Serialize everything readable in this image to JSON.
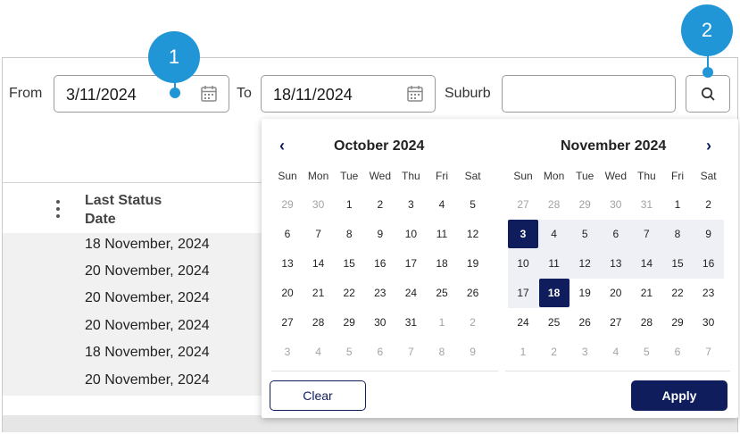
{
  "filter": {
    "from_label": "From",
    "from_value": "3/11/2024",
    "to_label": "To",
    "to_value": "18/11/2024",
    "suburb_label": "Suburb",
    "suburb_value": ""
  },
  "table": {
    "column_header_line1": "Last Status",
    "column_header_line2": "Date",
    "rows": [
      "18 November, 2024",
      "20 November, 2024",
      "20 November, 2024",
      "20 November, 2024",
      "18 November, 2024",
      "20 November, 2024"
    ]
  },
  "datepicker": {
    "weekdays": [
      "Sun",
      "Mon",
      "Tue",
      "Wed",
      "Thu",
      "Fri",
      "Sat"
    ],
    "left": {
      "title": "October 2024",
      "weeks": [
        [
          "29",
          "30",
          "1",
          "2",
          "3",
          "4",
          "5"
        ],
        [
          "6",
          "7",
          "8",
          "9",
          "10",
          "11",
          "12"
        ],
        [
          "13",
          "14",
          "15",
          "16",
          "17",
          "18",
          "19"
        ],
        [
          "20",
          "21",
          "22",
          "23",
          "24",
          "25",
          "26"
        ],
        [
          "27",
          "28",
          "29",
          "30",
          "31",
          "1",
          "2"
        ],
        [
          "3",
          "4",
          "5",
          "6",
          "7",
          "8",
          "9"
        ]
      ],
      "muted_first_row_count": 2,
      "muted_tail_from_index": 33
    },
    "right": {
      "title": "November 2024",
      "weeks": [
        [
          "27",
          "28",
          "29",
          "30",
          "31",
          "1",
          "2"
        ],
        [
          "3",
          "4",
          "5",
          "6",
          "7",
          "8",
          "9"
        ],
        [
          "10",
          "11",
          "12",
          "13",
          "14",
          "15",
          "16"
        ],
        [
          "17",
          "18",
          "19",
          "20",
          "21",
          "22",
          "23"
        ],
        [
          "24",
          "25",
          "26",
          "27",
          "28",
          "29",
          "30"
        ],
        [
          "1",
          "2",
          "3",
          "4",
          "5",
          "6",
          "7"
        ]
      ],
      "muted_first_row_count": 5,
      "muted_tail_from_index": 35,
      "range_start_index": 7,
      "range_end_index": 22
    },
    "prev_glyph": "‹",
    "next_glyph": "›",
    "clear_label": "Clear",
    "apply_label": "Apply"
  },
  "callouts": {
    "one": "1",
    "two": "2"
  },
  "colors": {
    "accent_navy": "#0f1d5c",
    "callout_blue": "#2196d6",
    "range_bg": "#eef0f5"
  },
  "icons": [
    "calendar-icon",
    "search-icon",
    "kebab-menu-icon",
    "chevron-left-icon",
    "chevron-right-icon"
  ]
}
